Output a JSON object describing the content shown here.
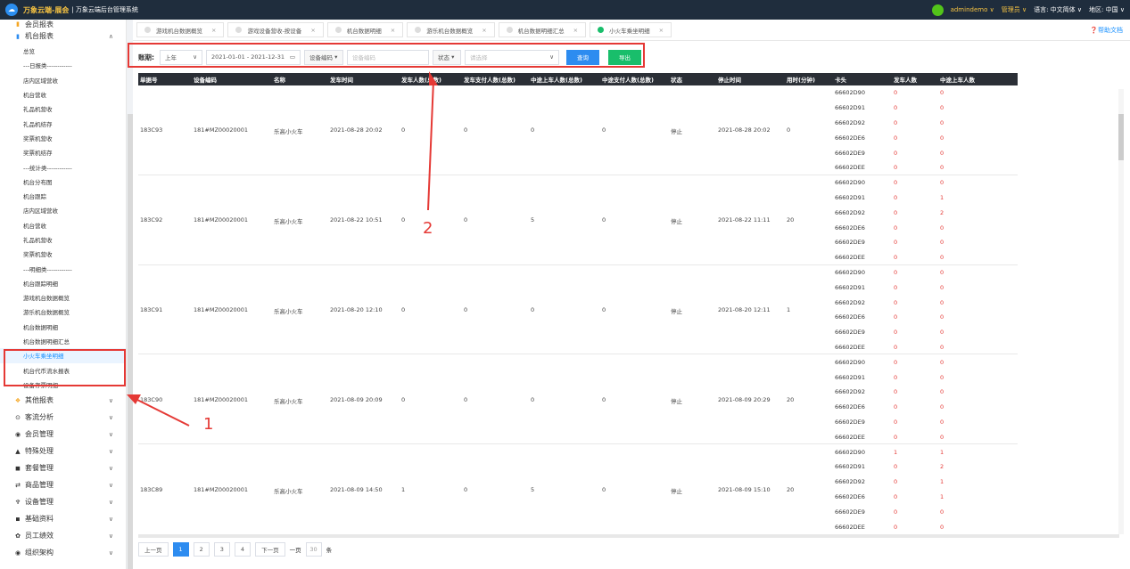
{
  "header": {
    "brand": "万象云端-展会",
    "system_name": "万象云端后台管理系统",
    "user": "admindemo",
    "role": "管理员",
    "language": "语言: 中文简体",
    "region": "地区: 中国"
  },
  "sidebar": {
    "top_group": "会员报表",
    "machine_group": "机台报表",
    "items": [
      "总览",
      "---日报类------------",
      "店内区域营收",
      "机台营收",
      "礼品机营收",
      "礼品机结存",
      "奖票机营收",
      "奖票机结存",
      "---统计类------------",
      "机台分布图",
      "机台跟踪",
      "店内区域营收",
      "机台营收",
      "礼品机营收",
      "奖票机营收",
      "---明细类------------",
      "机台跟踪明细",
      "游戏机台数据概览",
      "游乐机台数据概览",
      "机台数据明细",
      "机台数据明细汇总",
      "小火车乘坐明细",
      "机台代币流水报表",
      "设备存票明细"
    ],
    "active_item": "小火车乘坐明细",
    "groups": [
      "其他报表",
      "客流分析",
      "会员管理",
      "特殊处理",
      "套餐管理",
      "商品管理",
      "设备管理",
      "基础资料",
      "员工绩效",
      "组织架构"
    ]
  },
  "tabs": [
    {
      "label": "游戏机台数据概览"
    },
    {
      "label": "游戏设备营收-按设备"
    },
    {
      "label": "机台数据明细"
    },
    {
      "label": "游乐机台数据概览"
    },
    {
      "label": "机台数据明细汇总"
    },
    {
      "label": "小火车乘坐明细"
    }
  ],
  "help_label": "帮助文档",
  "filter": {
    "period_label": "账期:",
    "period_value": "上年",
    "date_range": "2021-01-01 - 2021-12-31",
    "device_code_label": "设备编码",
    "device_code_placeholder": "设备编码",
    "status_label": "状态",
    "status_placeholder": "请选择",
    "query_button": "查询",
    "export_button": "导出"
  },
  "table": {
    "columns": [
      "单据号",
      "设备编码",
      "名称",
      "发车时间",
      "发车人数(总数)",
      "发车支付人数(总数)",
      "中途上车人数(总数)",
      "中途支付人数(总数)",
      "状态",
      "停止时间",
      "用时(分钟)",
      "卡头",
      "发车人数",
      "中途上车人数"
    ],
    "rows": [
      {
        "id": "183C93",
        "code": "181#MZ00020001",
        "name": "乐高小火车",
        "start": "2021-08-28 20:02",
        "depart": "0",
        "depart_pay": "0",
        "mid": "0",
        "mid_pay": "0",
        "status": "停止",
        "stop": "2021-08-28 20:02",
        "mins": "0",
        "subs": [
          [
            "66602D90",
            "0",
            "0"
          ],
          [
            "66602D91",
            "0",
            "0"
          ],
          [
            "66602D92",
            "0",
            "0"
          ],
          [
            "66602DE6",
            "0",
            "0"
          ],
          [
            "66602DE9",
            "0",
            "0"
          ],
          [
            "66602DEE",
            "0",
            "0"
          ]
        ]
      },
      {
        "id": "183C92",
        "code": "181#MZ00020001",
        "name": "乐高小火车",
        "start": "2021-08-22 10:51",
        "depart": "0",
        "depart_pay": "0",
        "mid": "5",
        "mid_pay": "0",
        "status": "停止",
        "stop": "2021-08-22 11:11",
        "mins": "20",
        "subs": [
          [
            "66602D90",
            "0",
            "0"
          ],
          [
            "66602D91",
            "0",
            "1"
          ],
          [
            "66602D92",
            "0",
            "2"
          ],
          [
            "66602DE6",
            "0",
            "0"
          ],
          [
            "66602DE9",
            "0",
            "0"
          ],
          [
            "66602DEE",
            "0",
            "0"
          ]
        ]
      },
      {
        "id": "183C91",
        "code": "181#MZ00020001",
        "name": "乐高小火车",
        "start": "2021-08-20 12:10",
        "depart": "0",
        "depart_pay": "0",
        "mid": "0",
        "mid_pay": "0",
        "status": "停止",
        "stop": "2021-08-20 12:11",
        "mins": "1",
        "subs": [
          [
            "66602D90",
            "0",
            "0"
          ],
          [
            "66602D91",
            "0",
            "0"
          ],
          [
            "66602D92",
            "0",
            "0"
          ],
          [
            "66602DE6",
            "0",
            "0"
          ],
          [
            "66602DE9",
            "0",
            "0"
          ],
          [
            "66602DEE",
            "0",
            "0"
          ]
        ]
      },
      {
        "id": "183C90",
        "code": "181#MZ00020001",
        "name": "乐高小火车",
        "start": "2021-08-09 20:09",
        "depart": "0",
        "depart_pay": "0",
        "mid": "0",
        "mid_pay": "0",
        "status": "停止",
        "stop": "2021-08-09 20:29",
        "mins": "20",
        "subs": [
          [
            "66602D90",
            "0",
            "0"
          ],
          [
            "66602D91",
            "0",
            "0"
          ],
          [
            "66602D92",
            "0",
            "0"
          ],
          [
            "66602DE6",
            "0",
            "0"
          ],
          [
            "66602DE9",
            "0",
            "0"
          ],
          [
            "66602DEE",
            "0",
            "0"
          ]
        ]
      },
      {
        "id": "183C89",
        "code": "181#MZ00020001",
        "name": "乐高小火车",
        "start": "2021-08-09 14:50",
        "depart": "1",
        "depart_pay": "0",
        "mid": "5",
        "mid_pay": "0",
        "status": "停止",
        "stop": "2021-08-09 15:10",
        "mins": "20",
        "subs": [
          [
            "66602D90",
            "1",
            "1"
          ],
          [
            "66602D91",
            "0",
            "2"
          ],
          [
            "66602D92",
            "0",
            "1"
          ],
          [
            "66602DE6",
            "0",
            "1"
          ],
          [
            "66602DE9",
            "0",
            "0"
          ],
          [
            "66602DEE",
            "0",
            "0"
          ]
        ]
      }
    ]
  },
  "pager": {
    "prev": "上一页",
    "pages": [
      "1",
      "2",
      "3",
      "4"
    ],
    "current": "1",
    "next": "下一页",
    "per_page_label": "一页",
    "per_page": "30",
    "unit": "条"
  },
  "annotations": {
    "label_1": "1",
    "label_2": "2"
  },
  "colors": {
    "accent": "#2d8cf0",
    "export": "#19be6b",
    "header_bg": "#1f2d3d",
    "annotation": "#e53935"
  }
}
